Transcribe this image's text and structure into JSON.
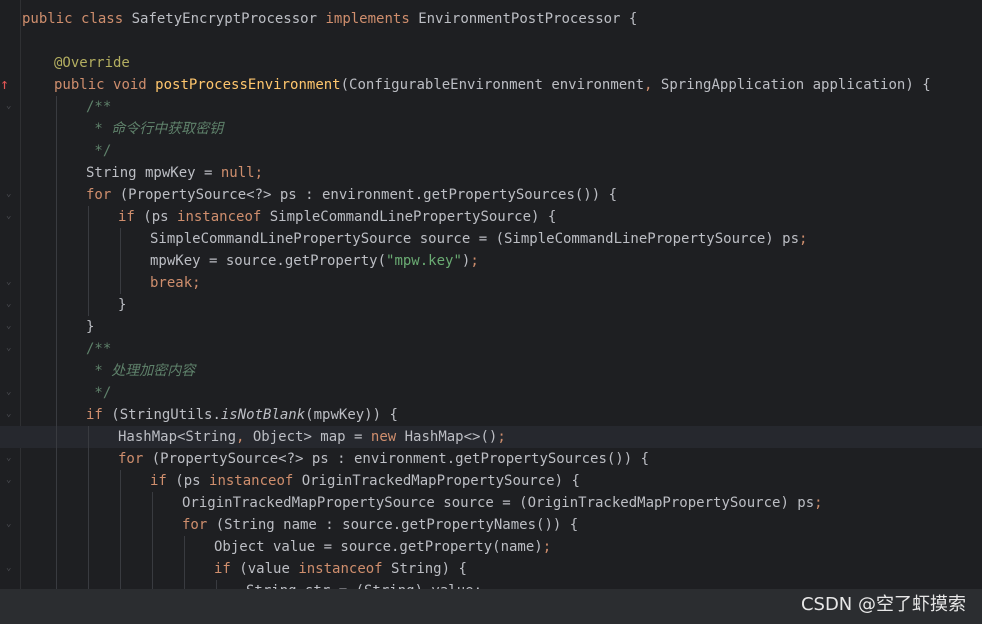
{
  "editor": {
    "lines": [
      {
        "indent": 0,
        "tokens": [
          [
            "kw",
            "public "
          ],
          [
            "kw",
            "class "
          ],
          [
            "plain",
            "SafetyEncryptProcessor "
          ],
          [
            "kw",
            "implements "
          ],
          [
            "plain",
            "EnvironmentPostProcessor {"
          ]
        ]
      },
      {
        "indent": 0,
        "tokens": []
      },
      {
        "indent": 1,
        "tokens": [
          [
            "ann",
            "@Override"
          ]
        ]
      },
      {
        "indent": 1,
        "tokens": [
          [
            "kw",
            "public "
          ],
          [
            "kw",
            "void "
          ],
          [
            "fnd",
            "postProcessEnvironment"
          ],
          [
            "plain",
            "(ConfigurableEnvironment environment"
          ],
          [
            "kw",
            ", "
          ],
          [
            "plain",
            "SpringApplication application) {"
          ]
        ]
      },
      {
        "indent": 2,
        "tokens": [
          [
            "cmt",
            "/**"
          ]
        ]
      },
      {
        "indent": 2,
        "tokens": [
          [
            "cmti",
            " * 命令行中获取密钥"
          ]
        ]
      },
      {
        "indent": 2,
        "tokens": [
          [
            "cmt",
            " */"
          ]
        ]
      },
      {
        "indent": 2,
        "tokens": [
          [
            "plain",
            "String mpwKey = "
          ],
          [
            "kw",
            "null"
          ],
          [
            "kw",
            ";"
          ]
        ]
      },
      {
        "indent": 2,
        "tokens": [
          [
            "kw",
            "for "
          ],
          [
            "plain",
            "(PropertySource<?> ps : environment.getPropertySources()) {"
          ]
        ]
      },
      {
        "indent": 3,
        "tokens": [
          [
            "kw",
            "if "
          ],
          [
            "plain",
            "(ps "
          ],
          [
            "kw",
            "instanceof "
          ],
          [
            "plain",
            "SimpleCommandLinePropertySource) {"
          ]
        ]
      },
      {
        "indent": 4,
        "tokens": [
          [
            "plain",
            "SimpleCommandLinePropertySource source = (SimpleCommandLinePropertySource) ps"
          ],
          [
            "kw",
            ";"
          ]
        ]
      },
      {
        "indent": 4,
        "tokens": [
          [
            "plain",
            "mpwKey = source.getProperty("
          ],
          [
            "str",
            "\"mpw.key\""
          ],
          [
            "plain",
            ")"
          ],
          [
            "kw",
            ";"
          ]
        ]
      },
      {
        "indent": 4,
        "tokens": [
          [
            "kw",
            "break;"
          ]
        ]
      },
      {
        "indent": 3,
        "tokens": [
          [
            "plain",
            "}"
          ]
        ]
      },
      {
        "indent": 2,
        "tokens": [
          [
            "plain",
            "}"
          ]
        ]
      },
      {
        "indent": 2,
        "tokens": [
          [
            "cmt",
            "/**"
          ]
        ]
      },
      {
        "indent": 2,
        "tokens": [
          [
            "cmti",
            " * 处理加密内容"
          ]
        ]
      },
      {
        "indent": 2,
        "tokens": [
          [
            "cmt",
            " */"
          ]
        ]
      },
      {
        "indent": 2,
        "tokens": [
          [
            "kw",
            "if "
          ],
          [
            "plain",
            "(StringUtils."
          ],
          [
            "it",
            "isNotBlank"
          ],
          [
            "plain",
            "(mpwKey)) {"
          ]
        ]
      },
      {
        "indent": 3,
        "current": true,
        "tokens": [
          [
            "plain",
            "HashMap<String"
          ],
          [
            "kw",
            ", "
          ],
          [
            "plain",
            "Object> map = "
          ],
          [
            "kw",
            "new "
          ],
          [
            "plain",
            "HashMap<>()"
          ],
          [
            "kw",
            ";"
          ]
        ]
      },
      {
        "indent": 3,
        "tokens": [
          [
            "kw",
            "for "
          ],
          [
            "plain",
            "(PropertySource<?> ps : environment.getPropertySources()) {"
          ]
        ]
      },
      {
        "indent": 4,
        "tokens": [
          [
            "kw",
            "if "
          ],
          [
            "plain",
            "(ps "
          ],
          [
            "kw",
            "instanceof "
          ],
          [
            "plain",
            "OriginTrackedMapPropertySource) {"
          ]
        ]
      },
      {
        "indent": 5,
        "tokens": [
          [
            "plain",
            "OriginTrackedMapPropertySource source = (OriginTrackedMapPropertySource) ps"
          ],
          [
            "kw",
            ";"
          ]
        ]
      },
      {
        "indent": 5,
        "tokens": [
          [
            "kw",
            "for "
          ],
          [
            "plain",
            "(String name : source.getPropertyNames()) {"
          ]
        ]
      },
      {
        "indent": 6,
        "tokens": [
          [
            "plain",
            "Object value = source.getProperty(name)"
          ],
          [
            "kw",
            ";"
          ]
        ]
      },
      {
        "indent": 6,
        "tokens": [
          [
            "kw",
            "if "
          ],
          [
            "plain",
            "(value "
          ],
          [
            "kw",
            "instanceof "
          ],
          [
            "plain",
            "String) {"
          ]
        ]
      },
      {
        "indent": 7,
        "tokens": [
          [
            "plain",
            "String str = (String) value;"
          ]
        ]
      }
    ]
  },
  "watermark": "CSDN @空了虾摸索",
  "colors": {
    "background": "#1e1f22",
    "keyword": "#cf8e6d",
    "annotation": "#b3ae60",
    "method_decl": "#ffc66d",
    "string": "#6aab73",
    "comment": "#5f826b"
  }
}
